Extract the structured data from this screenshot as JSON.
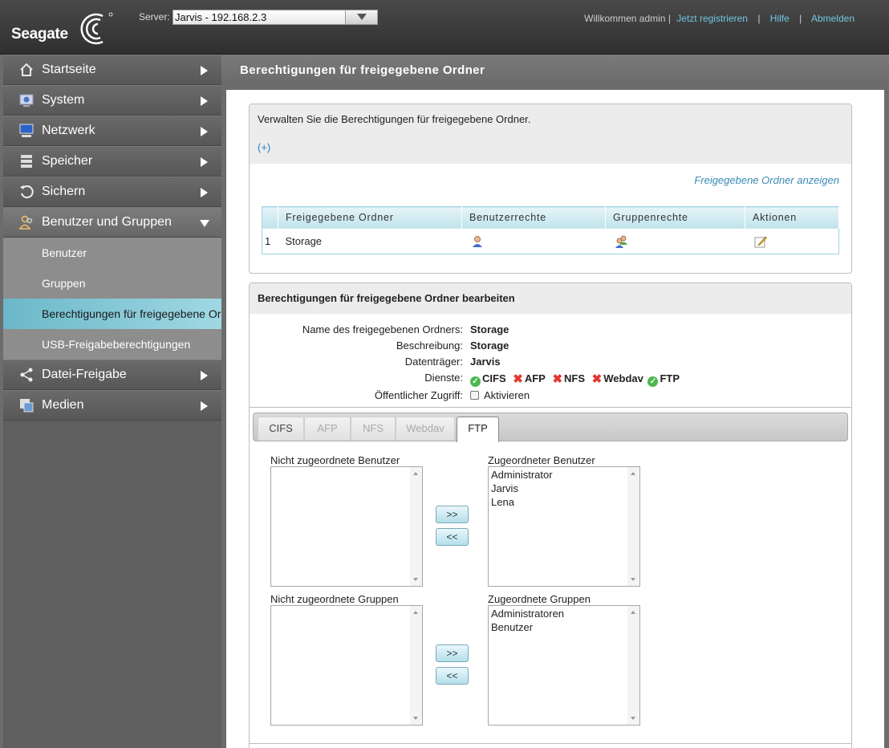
{
  "header": {
    "logo_text": "Seagate",
    "server_label": "Server:",
    "server_value": "Jarvis - 192.168.2.3",
    "welcome": "Willkommen admin |",
    "register": "Jetzt registrieren",
    "help": "Hilfe",
    "logout": "Abmelden",
    "sep": "|"
  },
  "sidebar": {
    "items": [
      {
        "label": "Startseite",
        "icon": "home-icon"
      },
      {
        "label": "System",
        "icon": "system-icon"
      },
      {
        "label": "Netzwerk",
        "icon": "network-icon"
      },
      {
        "label": "Speicher",
        "icon": "storage-icon"
      },
      {
        "label": "Sichern",
        "icon": "backup-icon"
      },
      {
        "label": "Benutzer und Gruppen",
        "icon": "users-icon"
      },
      {
        "label": "Datei-Freigabe",
        "icon": "share-icon"
      },
      {
        "label": "Medien",
        "icon": "media-icon"
      }
    ],
    "sub_items": [
      {
        "label": "Benutzer"
      },
      {
        "label": "Gruppen"
      },
      {
        "label": "Berechtigungen für freigegebene Ordner"
      },
      {
        "label": "USB-Freigabeberechtigungen"
      }
    ]
  },
  "main": {
    "title": "Berechtigungen für freigegebene Ordner",
    "panel1": {
      "description": "Verwalten Sie die Berechtigungen für freigegebene Ordner.",
      "add_link": "(+)",
      "show_link": "Freigegebene Ordner anzeigen",
      "columns": [
        "Freigegebene Ordner",
        "Benutzerrechte",
        "Gruppenrechte",
        "Aktionen"
      ],
      "rows": [
        {
          "num": "1",
          "folder": "Storage"
        }
      ]
    },
    "panel2": {
      "title": "Berechtigungen für freigegebene Ordner bearbeiten",
      "fields": {
        "name_label": "Name des freigegebenen Ordners:",
        "name_value": "Storage",
        "desc_label": "Beschreibung:",
        "desc_value": "Storage",
        "disk_label": "Datenträger:",
        "disk_value": "Jarvis",
        "services_label": "Dienste:",
        "public_label": "Öffentlicher Zugriff:",
        "public_value": "Aktivieren"
      },
      "services": [
        {
          "name": "CIFS",
          "status": "enabled"
        },
        {
          "name": "AFP",
          "status": "disabled"
        },
        {
          "name": "NFS",
          "status": "disabled"
        },
        {
          "name": "Webdav",
          "status": "disabled"
        },
        {
          "name": "FTP",
          "status": "enabled"
        }
      ],
      "tabs": [
        {
          "label": "CIFS",
          "state": "enabled"
        },
        {
          "label": "AFP",
          "state": "disabled"
        },
        {
          "label": "NFS",
          "state": "disabled"
        },
        {
          "label": "Webdav",
          "state": "disabled"
        },
        {
          "label": "FTP",
          "state": "active"
        }
      ],
      "unassigned_users_label": "Nicht zugeordnete Benutzer",
      "assigned_users_label": "Zugeordneter Benutzer",
      "assigned_users": [
        "Administrator",
        "Jarvis",
        "Lena"
      ],
      "unassigned_groups_label": "Nicht zugeordnete Gruppen",
      "assigned_groups_label": "Zugeordnete Gruppen",
      "assigned_groups": [
        "Administratoren",
        "Benutzer"
      ],
      "add_btn": ">>",
      "remove_btn": "<<"
    }
  },
  "colors": {
    "accent": "#6bb8c9",
    "link": "#6fc6df",
    "ok": "#4db84d",
    "error": "#e23a2d"
  }
}
